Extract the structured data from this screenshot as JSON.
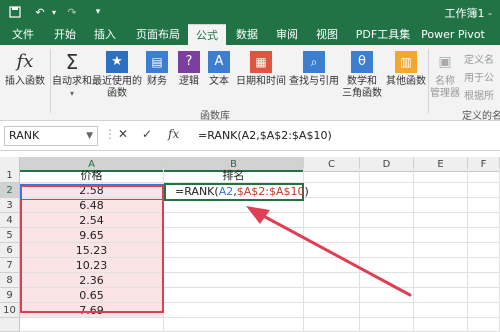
{
  "titlebar": {
    "title": "工作簿1 - ",
    "icons": [
      "save-icon",
      "undo-icon",
      "redo-icon",
      "customize-icon"
    ]
  },
  "tabs": [
    "文件",
    "开始",
    "插入",
    "页面布局",
    "公式",
    "数据",
    "审阅",
    "视图",
    "PDF工具集",
    "Power Pivot"
  ],
  "active_tab": "公式",
  "ribbon": {
    "buttons": [
      {
        "label1": "插入函数",
        "label2": "",
        "icon": "fx-icon"
      },
      {
        "label1": "自动求和",
        "label2": "",
        "icon": "sigma-icon"
      },
      {
        "label1": "最近使用的",
        "label2": "函数",
        "icon": "star-icon"
      },
      {
        "label1": "财务",
        "label2": "",
        "icon": "finance-icon"
      },
      {
        "label1": "逻辑",
        "label2": "",
        "icon": "logic-icon"
      },
      {
        "label1": "文本",
        "label2": "",
        "icon": "text-icon"
      },
      {
        "label1": "日期和时间",
        "label2": "",
        "icon": "calendar-icon"
      },
      {
        "label1": "查找与引用",
        "label2": "",
        "icon": "lookup-icon"
      },
      {
        "label1": "数学和",
        "label2": "三角函数",
        "icon": "theta-icon"
      },
      {
        "label1": "其他函数",
        "label2": "",
        "icon": "more-functions-icon"
      },
      {
        "label1": "名称",
        "label2": "管理器",
        "icon": "name-manager-icon"
      }
    ],
    "group_label": "函数库",
    "side_items": [
      "定义名",
      "用于公",
      "根据所"
    ],
    "side_group_label": "定义的名"
  },
  "formula_bar": {
    "name_box": "RANK",
    "cancel": "✕",
    "enter": "✓",
    "fx": "fx",
    "formula": "=RANK(A2,$A$2:$A$10)"
  },
  "grid": {
    "columns": [
      "A",
      "B",
      "C",
      "D",
      "E",
      "F"
    ],
    "rows": [
      "1",
      "2",
      "3",
      "4",
      "5",
      "6",
      "7",
      "8",
      "9",
      "10"
    ],
    "headers": {
      "A": "价格",
      "B": "排名"
    },
    "prices": [
      "2.58",
      "6.48",
      "2.54",
      "9.65",
      "15.23",
      "10.23",
      "2.36",
      "0.65",
      "7.69"
    ],
    "edit": {
      "prefix": "=RANK(",
      "ref": "A2",
      "sep": ",",
      "range": "$A$2:$A$10",
      "suffix": ")"
    }
  },
  "colors": {
    "excel_green": "#217346",
    "range_red": "#e03e54",
    "ref_blue": "#3b74d6"
  }
}
